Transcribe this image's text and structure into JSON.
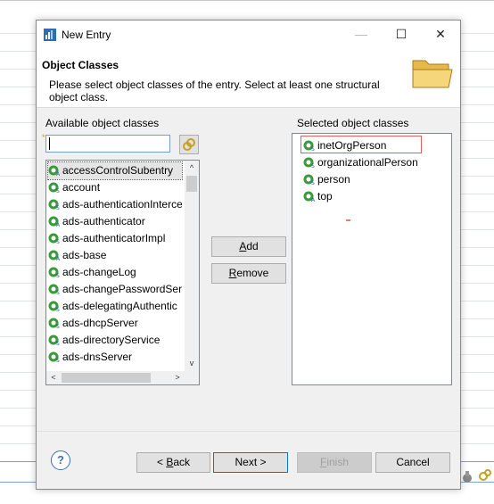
{
  "window": {
    "title": "New Entry",
    "minimize_glyph": "—",
    "maximize_glyph": "☐",
    "close_glyph": "✕",
    "icon": "app-icon"
  },
  "header": {
    "title": "Object Classes",
    "description": "Please select object classes of the entry. Select at least one structural object class.",
    "icon": "folder-icon"
  },
  "available": {
    "label": "Available object classes",
    "filter_value": "",
    "required_mark": "*",
    "items": [
      {
        "label": "accessControlSubentry",
        "icon": "object-class-icon"
      },
      {
        "label": "account",
        "icon": "object-class-icon"
      },
      {
        "label": "ads-authenticationInterce",
        "icon": "object-class-icon"
      },
      {
        "label": "ads-authenticator",
        "icon": "object-class-icon"
      },
      {
        "label": "ads-authenticatorImpl",
        "icon": "object-class-icon"
      },
      {
        "label": "ads-base",
        "icon": "object-class-icon"
      },
      {
        "label": "ads-changeLog",
        "icon": "object-class-icon"
      },
      {
        "label": "ads-changePasswordSer",
        "icon": "object-class-icon"
      },
      {
        "label": "ads-delegatingAuthentic",
        "icon": "object-class-icon"
      },
      {
        "label": "ads-dhcpServer",
        "icon": "object-class-icon"
      },
      {
        "label": "ads-directoryService",
        "icon": "object-class-icon"
      },
      {
        "label": "ads-dnsServer",
        "icon": "object-class-icon"
      }
    ]
  },
  "selected": {
    "label": "Selected object classes",
    "items": [
      {
        "label": "inetOrgPerson",
        "icon": "object-class-icon"
      },
      {
        "label": "organizationalPerson",
        "icon": "object-class-icon"
      },
      {
        "label": "person",
        "icon": "object-class-icon"
      },
      {
        "label": "top",
        "icon": "object-class-icon"
      }
    ]
  },
  "buttons": {
    "add_pre": "",
    "add_key": "A",
    "add_post": "dd",
    "remove_pre": "",
    "remove_key": "R",
    "remove_post": "emove",
    "back_pre": "< ",
    "back_key": "B",
    "back_post": "ack",
    "next": "Next >",
    "finish_pre": "",
    "finish_key": "F",
    "finish_post": "inish",
    "cancel": "Cancel",
    "help": "?"
  },
  "scroll": {
    "up": "^",
    "down": "v",
    "left": "<",
    "right": ">"
  },
  "colors": {
    "accent": "#0078d7",
    "highlight_box": "#e06060",
    "icon_green": "#3a9a3a"
  }
}
